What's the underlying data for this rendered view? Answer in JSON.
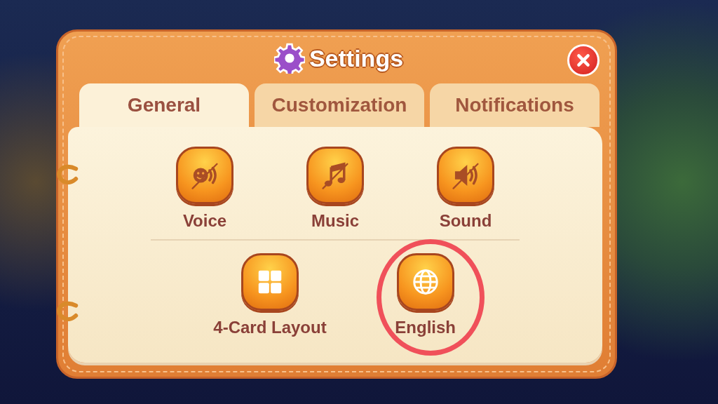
{
  "title": "Settings",
  "tabs": [
    {
      "label": "General",
      "selected": true
    },
    {
      "label": "Customization",
      "selected": false
    },
    {
      "label": "Notifications",
      "selected": false
    }
  ],
  "option_rows": [
    [
      {
        "label": "Voice",
        "kind": "voice",
        "muted": true,
        "highlighted": false
      },
      {
        "label": "Music",
        "kind": "music",
        "muted": true,
        "highlighted": false
      },
      {
        "label": "Sound",
        "kind": "sound",
        "muted": true,
        "highlighted": false
      }
    ],
    [
      {
        "label": "4-Card Layout",
        "kind": "layout",
        "muted": false,
        "highlighted": false
      },
      {
        "label": "English",
        "kind": "language",
        "muted": false,
        "highlighted": true
      }
    ]
  ]
}
